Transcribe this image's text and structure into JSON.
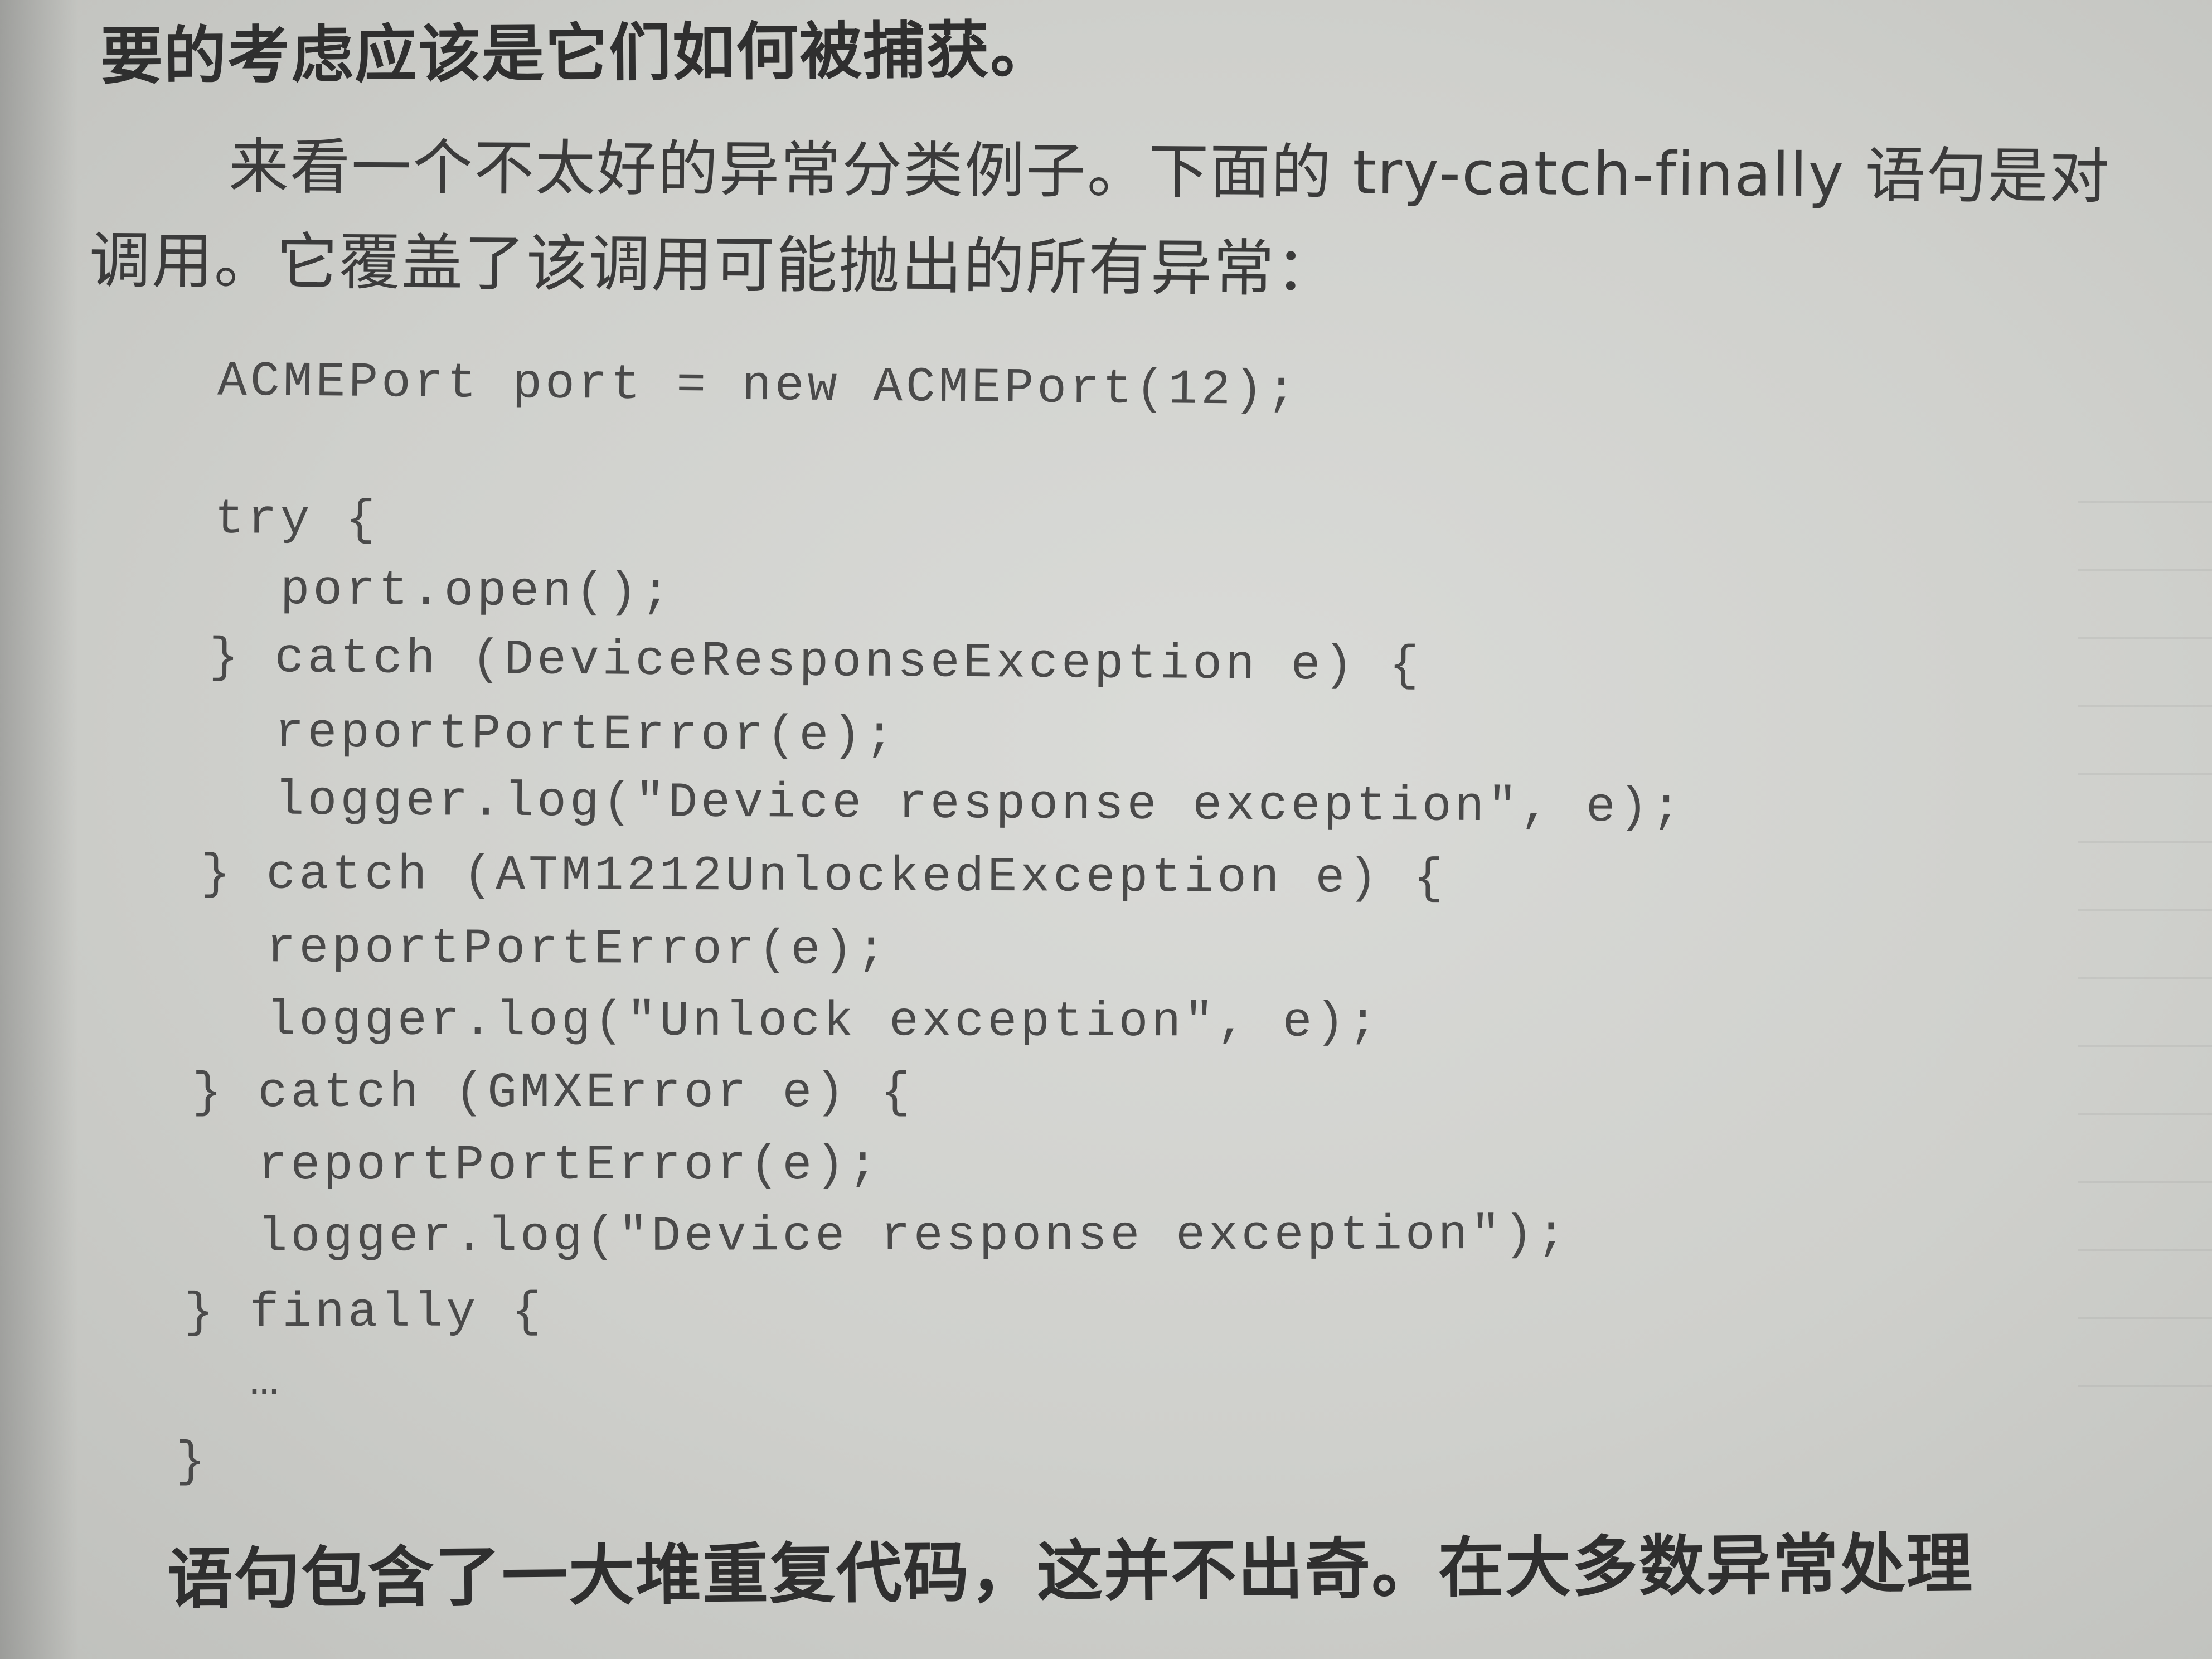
{
  "prose": {
    "line1": "要的考虑应该是它们如何被捕获。",
    "line2": "来看一个不太好的异常分类例子。下面的 try-catch-finally 语句是对",
    "line3": "调用。它覆盖了该调用可能抛出的所有异常：",
    "line4": "语句包含了一大堆重复代码，这并不出奇。在大多数异常处理"
  },
  "code": {
    "l1": "ACMEPort port = new ACMEPort(12);",
    "l2": "try {",
    "l3": "  port.open();",
    "l4": "} catch (DeviceResponseException e) {",
    "l5": "  reportPortError(e);",
    "l6": "  logger.log(\"Device response exception\", e);",
    "l7": "} catch (ATM1212UnlockedException e) {",
    "l8": "  reportPortError(e);",
    "l9": "  logger.log(\"Unlock exception\", e);",
    "l10": "} catch (GMXError e) {",
    "l11": "  reportPortError(e);",
    "l12": "  logger.log(\"Device response exception\");",
    "l13": "} finally {",
    "l14": "  …",
    "l15": "}"
  }
}
